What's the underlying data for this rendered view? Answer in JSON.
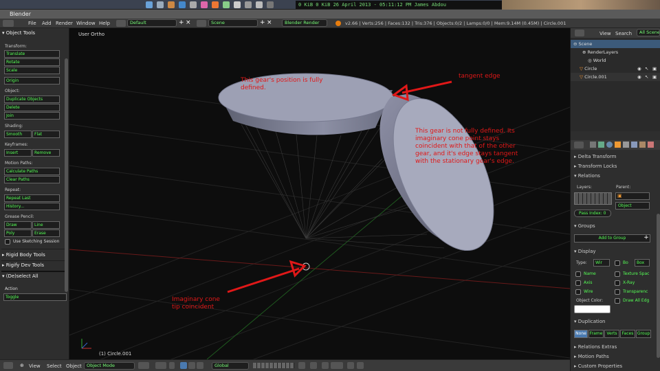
{
  "os": {
    "clock": "0 KiB 0 KiB 26 April 2013 - 05:11:12 PM James Abdou"
  },
  "window": {
    "title": "Blender"
  },
  "header": {
    "menus": [
      "File",
      "Add",
      "Render",
      "Window",
      "Help"
    ],
    "layout": "Default",
    "scene": "Scene",
    "engine": "Blender Render",
    "stats": "v2.66 | Verts:256 | Faces:132 | Tris:376 | Objects:0/2 | Lamps:0/0 | Mem:9.14M (0.45M) | Circle.001"
  },
  "tools": {
    "panel_title": "Object Tools",
    "transform_label": "Transform:",
    "translate": "Translate",
    "rotate": "Rotate",
    "scale": "Scale",
    "origin": "Origin",
    "object_label": "Object:",
    "duplicate": "Duplicate Objects",
    "delete": "Delete",
    "join": "Join",
    "shading_label": "Shading:",
    "smooth": "Smooth",
    "flat": "Flat",
    "keyframes_label": "Keyframes:",
    "insert": "Insert",
    "remove": "Remove",
    "motion_label": "Motion Paths:",
    "calc_paths": "Calculate Paths",
    "clear_paths": "Clear Paths",
    "repeat_label": "Repeat:",
    "repeat_last": "Repeat Last",
    "history": "History...",
    "grease_label": "Grease Pencil:",
    "draw": "Draw",
    "line": "Line",
    "poly": "Poly",
    "erase": "Erase",
    "sketch": "Use Sketching Session",
    "rigid": "Rigid Body Tools",
    "rigify": "Rigify Dev Tools",
    "deselect_title": "(De)select All",
    "action_label": "Action",
    "action_value": "Toggle"
  },
  "viewport": {
    "view_label": "User Ortho",
    "object_label": "(1) Circle.001"
  },
  "annotations": {
    "gear1": "This gear's position is fully defined.",
    "tangent": "tangent edge",
    "gear2": "This gear is not fully defined. Its imaginary cone point stays coincident with that of the other gear, and it's edge stays tangent with the stationary gear's edge.",
    "cone": "Imaginary cone tip coincident"
  },
  "outliner": {
    "view": "View",
    "search": "Search",
    "scenes": "All Scenes",
    "items": [
      "Scene",
      "RenderLayers",
      "World",
      "Circle",
      "Circle.001"
    ]
  },
  "properties": {
    "delta_transform": "Delta Transform",
    "transform_locks": "Transform Locks",
    "relations": "Relations",
    "layers": "Layers:",
    "parent": "Parent:",
    "pass_index": "Pass Index: 0",
    "parent_type": "Object",
    "groups": "Groups",
    "add_group": "Add to Group",
    "display": "Display",
    "type_label": "Type:",
    "type_value": "Wir",
    "bo": "Bo",
    "box": "Box",
    "name": "Name",
    "axis": "Axis",
    "wire": "Wire",
    "texture_space": "Texture Spac",
    "xray": "X-Ray",
    "transparency": "Transparenc",
    "object_color": "Object Color:",
    "draw_all_edges": "Draw All Edg",
    "duplication": "Duplication",
    "dup_modes": [
      "None",
      "Frame",
      "Verts",
      "Faces",
      "Group"
    ],
    "relations_extras": "Relations Extras",
    "motion_paths": "Motion Paths",
    "custom_props": "Custom Properties"
  },
  "bottom": {
    "menus": [
      "View",
      "Select",
      "Object"
    ],
    "mode": "Object Mode",
    "orientation": "Global"
  },
  "colors": {
    "accent": "#55ee55",
    "annotation": "#e01818",
    "panel": "#2e2e2e"
  }
}
